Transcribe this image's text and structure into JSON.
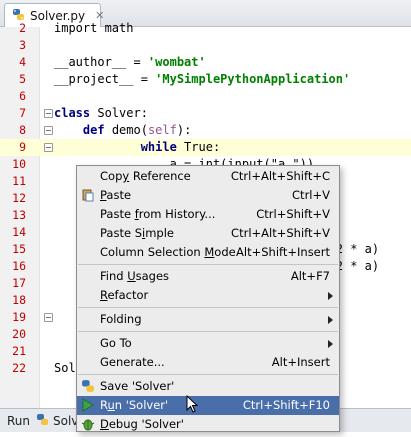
{
  "tab": {
    "title": "Solver.py",
    "close": "✕",
    "icon": "python-file-icon"
  },
  "code_lines": [
    {
      "n": "2",
      "text": "import math"
    },
    {
      "n": "3",
      "text": ""
    },
    {
      "n": "4",
      "pre": "__author__ = ",
      "str": "'wombat'"
    },
    {
      "n": "5",
      "pre": "__project__ = ",
      "str": "'MySimplePythonApplication'"
    },
    {
      "n": "6",
      "text": ""
    },
    {
      "n": "7",
      "kw": "class",
      "rest": " Solver:"
    },
    {
      "n": "8",
      "indent": "    ",
      "kw": "def",
      "rest": " demo(",
      "self": "self",
      "tail": "):"
    },
    {
      "n": "9",
      "indent": "            ",
      "kw": "while",
      "rest": " True:"
    },
    {
      "n": "10",
      "text": "                a = int(input(\"a \"))"
    },
    {
      "n": "11",
      "text": ""
    },
    {
      "n": "12",
      "text": ""
    },
    {
      "n": "13",
      "text": ""
    },
    {
      "n": "14",
      "text": ""
    },
    {
      "n": "15",
      "text": "                                      (2 * a)"
    },
    {
      "n": "16",
      "text": "                                      (2 * a)"
    },
    {
      "n": "17",
      "text": ""
    },
    {
      "n": "18",
      "text": ""
    },
    {
      "n": "19",
      "text": ""
    },
    {
      "n": "20",
      "text": ""
    },
    {
      "n": "21",
      "text": ""
    },
    {
      "n": "22",
      "text": "Sol"
    }
  ],
  "context_menu": {
    "items": [
      {
        "pre": "Cop",
        "u": "y",
        "post": " Reference",
        "shortcut": "Ctrl+Alt+Shift+C"
      },
      {
        "pre": "",
        "u": "P",
        "post": "aste",
        "shortcut": "Ctrl+V",
        "icon": "paste-icon"
      },
      {
        "pre": "Paste ",
        "u": "f",
        "post": "rom History...",
        "shortcut": "Ctrl+Shift+V"
      },
      {
        "pre": "Paste S",
        "u": "i",
        "post": "mple",
        "shortcut": "Ctrl+Alt+Shift+V"
      },
      {
        "pre": "Column Selection ",
        "u": "M",
        "post": "ode",
        "shortcut": "Alt+Shift+Insert"
      },
      {
        "sep": true
      },
      {
        "pre": "Find ",
        "u": "U",
        "post": "sages",
        "shortcut": "Alt+F7"
      },
      {
        "pre": "",
        "u": "R",
        "post": "efactor",
        "submenu": true
      },
      {
        "sep": true
      },
      {
        "pre": "Folding",
        "u": "",
        "post": "",
        "submenu": true
      },
      {
        "sep": true
      },
      {
        "pre": "Go To",
        "u": "",
        "post": "",
        "submenu": true
      },
      {
        "pre": "Generate...",
        "u": "",
        "post": "",
        "shortcut": "Alt+Insert"
      },
      {
        "sep": true
      },
      {
        "pre": "Save 'Solver'",
        "u": "",
        "post": "",
        "icon": "python-icon"
      },
      {
        "pre": "R",
        "u": "u",
        "post": "n 'Solver'",
        "shortcut": "Ctrl+Shift+F10",
        "icon": "run-icon",
        "selected": true
      },
      {
        "pre": "",
        "u": "D",
        "post": "ebug 'Solver'",
        "icon": "debug-icon"
      }
    ]
  },
  "run_bar": {
    "label": "Run",
    "tab": "Solver"
  },
  "colors": {
    "selection": "#4a6eaa",
    "current_line": "#ffffd7",
    "line_number": "#c00000",
    "keyword": "#000080",
    "string": "#008000"
  }
}
